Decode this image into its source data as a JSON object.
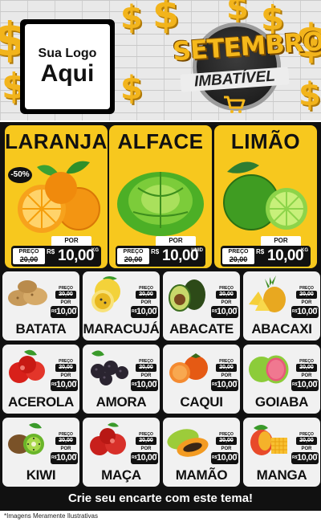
{
  "header": {
    "logo_line1": "Sua Logo",
    "logo_line2": "Aqui",
    "badge_title": "SETEMBRO",
    "badge_subtitle": "IMBATÍVEL",
    "dollar_symbol": "$"
  },
  "colors": {
    "yellow": "#f7c81e",
    "dark": "#111111",
    "card": "#f1f1f1",
    "gold": "#f2b41c"
  },
  "featured": [
    {
      "name": "LARANJA",
      "discount": "-50%",
      "old_label": "PREÇO",
      "old_price": "20,00",
      "por": "POR",
      "currency": "R$",
      "price": "10,00",
      "unit": "KG",
      "icon": "orange-icon"
    },
    {
      "name": "ALFACE",
      "old_label": "PREÇO",
      "old_price": "20,00",
      "por": "POR",
      "currency": "R$",
      "price": "10,00",
      "unit": "UNID",
      "icon": "lettuce-icon"
    },
    {
      "name": "LIMÃO",
      "old_label": "PREÇO",
      "old_price": "20,00",
      "por": "POR",
      "currency": "R$",
      "price": "10,00",
      "unit": "KG",
      "icon": "lime-icon"
    }
  ],
  "products": [
    {
      "name": "BATATA",
      "old_label": "PREÇO",
      "old_price": "20,00",
      "por": "POR",
      "currency": "R$",
      "price": "10,00",
      "unit": "KG",
      "icon": "potato-icon"
    },
    {
      "name": "MARACUJÁ",
      "old_label": "PREÇO",
      "old_price": "20,00",
      "por": "POR",
      "currency": "R$",
      "price": "10,00",
      "unit": "KG",
      "icon": "passion-fruit-icon"
    },
    {
      "name": "ABACATE",
      "old_label": "PREÇO",
      "old_price": "20,00",
      "por": "POR",
      "currency": "R$",
      "price": "10,00",
      "unit": "KG",
      "icon": "avocado-icon"
    },
    {
      "name": "ABACAXI",
      "old_label": "PREÇO",
      "old_price": "20,00",
      "por": "POR",
      "currency": "R$",
      "price": "10,00",
      "unit": "KG",
      "icon": "pineapple-icon"
    },
    {
      "name": "ACEROLA",
      "old_label": "PREÇO",
      "old_price": "20,00",
      "por": "POR",
      "currency": "R$",
      "price": "10,00",
      "unit": "KG",
      "icon": "acerola-icon"
    },
    {
      "name": "AMORA",
      "old_label": "PREÇO",
      "old_price": "20,00",
      "por": "POR",
      "currency": "R$",
      "price": "10,00",
      "unit": "KG",
      "icon": "blackberry-icon"
    },
    {
      "name": "CAQUI",
      "old_label": "PREÇO",
      "old_price": "20,00",
      "por": "POR",
      "currency": "R$",
      "price": "10,00",
      "unit": "KG",
      "icon": "persimmon-icon"
    },
    {
      "name": "GOIABA",
      "old_label": "PREÇO",
      "old_price": "20,00",
      "por": "POR",
      "currency": "R$",
      "price": "10,00",
      "unit": "KG",
      "icon": "guava-icon"
    },
    {
      "name": "KIWI",
      "old_label": "PREÇO",
      "old_price": "20,00",
      "por": "POR",
      "currency": "R$",
      "price": "10,00",
      "unit": "KG",
      "icon": "kiwi-icon"
    },
    {
      "name": "MAÇA",
      "old_label": "PREÇO",
      "old_price": "20,00",
      "por": "POR",
      "currency": "R$",
      "price": "10,00",
      "unit": "KG",
      "icon": "apple-icon"
    },
    {
      "name": "MAMÃO",
      "old_label": "PREÇO",
      "old_price": "20,00",
      "por": "POR",
      "currency": "R$",
      "price": "10,00",
      "unit": "KG",
      "icon": "papaya-icon"
    },
    {
      "name": "MANGA",
      "old_label": "PREÇO",
      "old_price": "20,00",
      "por": "POR",
      "currency": "R$",
      "price": "10,00",
      "unit": "KG",
      "icon": "mango-icon"
    }
  ],
  "footer": {
    "cta": "Crie seu encarte com este tema!",
    "disclaimer": "*Imagens Meramente Ilustrativas"
  }
}
